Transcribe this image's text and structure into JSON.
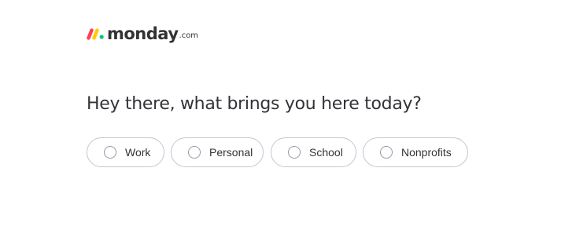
{
  "logo": {
    "wordmark": "monday",
    "suffix": ".com",
    "mark_colors": [
      "#ff3d57",
      "#ffcb00",
      "#00ca72"
    ]
  },
  "question": {
    "heading": "Hey there, what brings you here today?"
  },
  "options": [
    {
      "label": "Work",
      "selected": false
    },
    {
      "label": "Personal",
      "selected": false
    },
    {
      "label": "School",
      "selected": false
    },
    {
      "label": "Nonprofits",
      "selected": false
    }
  ],
  "colors": {
    "text": "#323338",
    "border": "#c3c6d4",
    "background": "#ffffff"
  }
}
